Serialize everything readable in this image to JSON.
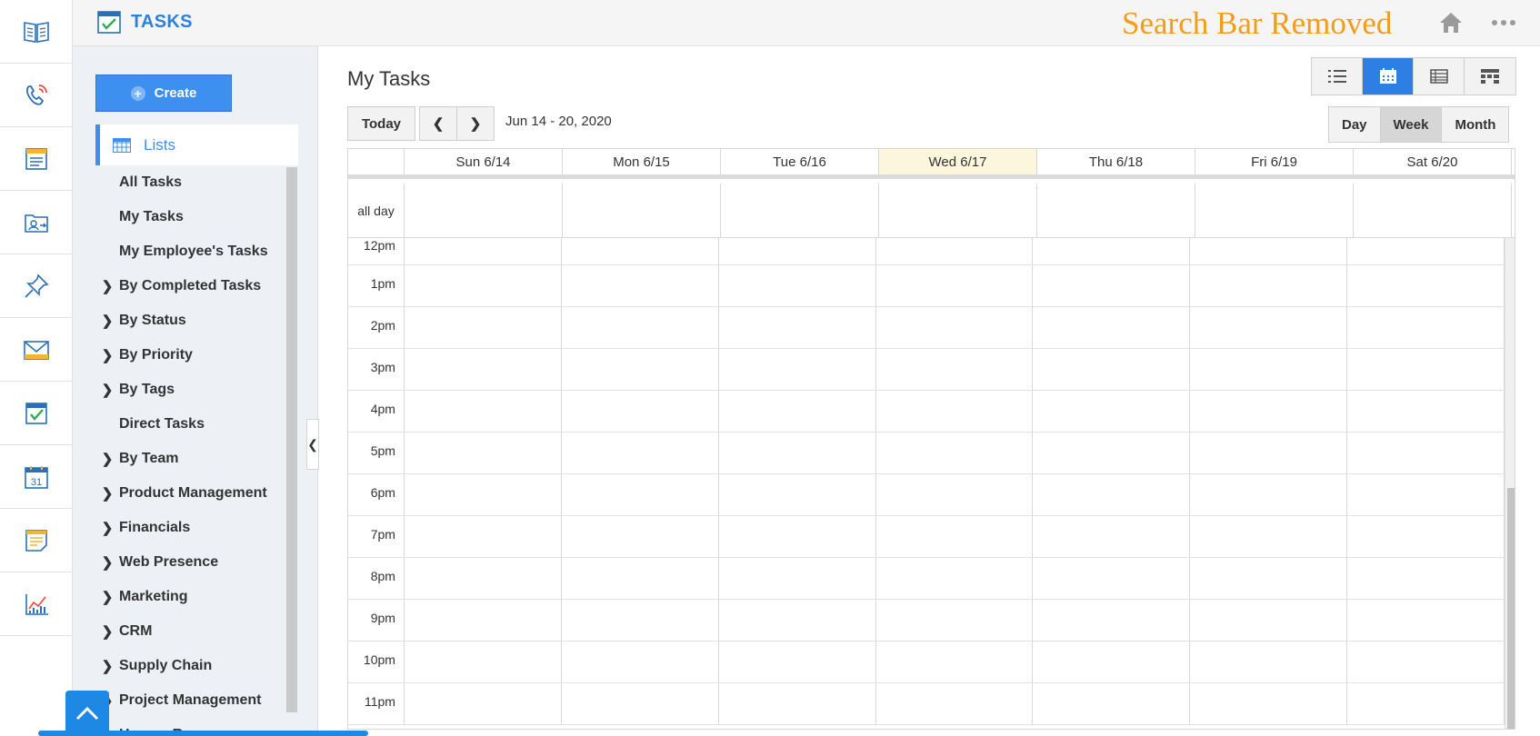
{
  "header": {
    "app_title": "TASKS",
    "overlay_note": "Search Bar Removed"
  },
  "rail": {
    "icons": [
      "book-icon",
      "phone-icon",
      "contacts-form-icon",
      "folder-contact-icon",
      "pin-icon",
      "mail-icon",
      "tasks-check-icon",
      "calendar-31-icon",
      "notes-icon",
      "chart-icon"
    ]
  },
  "sidebar": {
    "create_label": "Create",
    "lists_label": "Lists",
    "items": [
      {
        "label": "All Tasks",
        "expandable": false
      },
      {
        "label": "My Tasks",
        "expandable": false
      },
      {
        "label": "My Employee's Tasks",
        "expandable": false
      },
      {
        "label": "By Completed Tasks",
        "expandable": true
      },
      {
        "label": "By Status",
        "expandable": true
      },
      {
        "label": "By Priority",
        "expandable": true
      },
      {
        "label": "By Tags",
        "expandable": true
      },
      {
        "label": "Direct Tasks",
        "expandable": false
      },
      {
        "label": "By Team",
        "expandable": true
      },
      {
        "label": "Product Management",
        "expandable": true
      },
      {
        "label": "Financials",
        "expandable": true
      },
      {
        "label": "Web Presence",
        "expandable": true
      },
      {
        "label": "Marketing",
        "expandable": true
      },
      {
        "label": "CRM",
        "expandable": true
      },
      {
        "label": "Supply Chain",
        "expandable": true
      },
      {
        "label": "Project Management",
        "expandable": true
      },
      {
        "label": "Human Resources",
        "expandable": true
      }
    ]
  },
  "main": {
    "title": "My Tasks",
    "today_label": "Today",
    "date_range": "Jun 14 - 20, 2020",
    "views": [
      "list-view-icon",
      "calendar-view-icon",
      "table-view-icon",
      "kanban-view-icon"
    ],
    "active_view": "calendar-view-icon",
    "ranges": [
      "Day",
      "Week",
      "Month"
    ],
    "active_range": "Week"
  },
  "calendar": {
    "days": [
      "Sun 6/14",
      "Mon 6/15",
      "Tue 6/16",
      "Wed 6/17",
      "Thu 6/18",
      "Fri 6/19",
      "Sat 6/20"
    ],
    "today_index": 3,
    "all_day_label": "all day",
    "hours": [
      "12pm",
      "1pm",
      "2pm",
      "3pm",
      "4pm",
      "5pm",
      "6pm",
      "7pm",
      "8pm",
      "9pm",
      "10pm",
      "11pm"
    ]
  },
  "colors": {
    "accent": "#3d8ff0",
    "brand_title": "#2f80d8",
    "overlay_note": "#f39c1a",
    "today_column": "#fcf6dc"
  }
}
